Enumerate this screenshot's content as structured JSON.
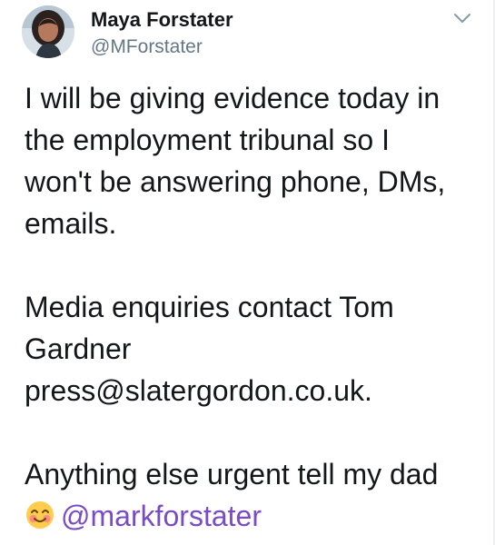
{
  "tweet": {
    "author": {
      "name": "Maya Forstater",
      "handle": "@MForstater",
      "avatar_icon": "profile-photo"
    },
    "menu_icon": "chevron-down-icon",
    "lines": [
      "I will be giving evidence today in",
      "the employment tribunal so I",
      "won't be answering phone, DMs,",
      "emails.",
      "",
      "Media enquiries contact Tom",
      "Gardner",
      "press@slatergordon.co.uk.",
      "",
      "Anything else urgent tell my dad"
    ],
    "final_line": {
      "emoji": "smiling-face-with-smiling-eyes",
      "mention": "@markforstater"
    }
  },
  "colors": {
    "text": "#14171a",
    "secondary": "#657786",
    "mention": "#794bc4",
    "background": "#ffffff"
  }
}
